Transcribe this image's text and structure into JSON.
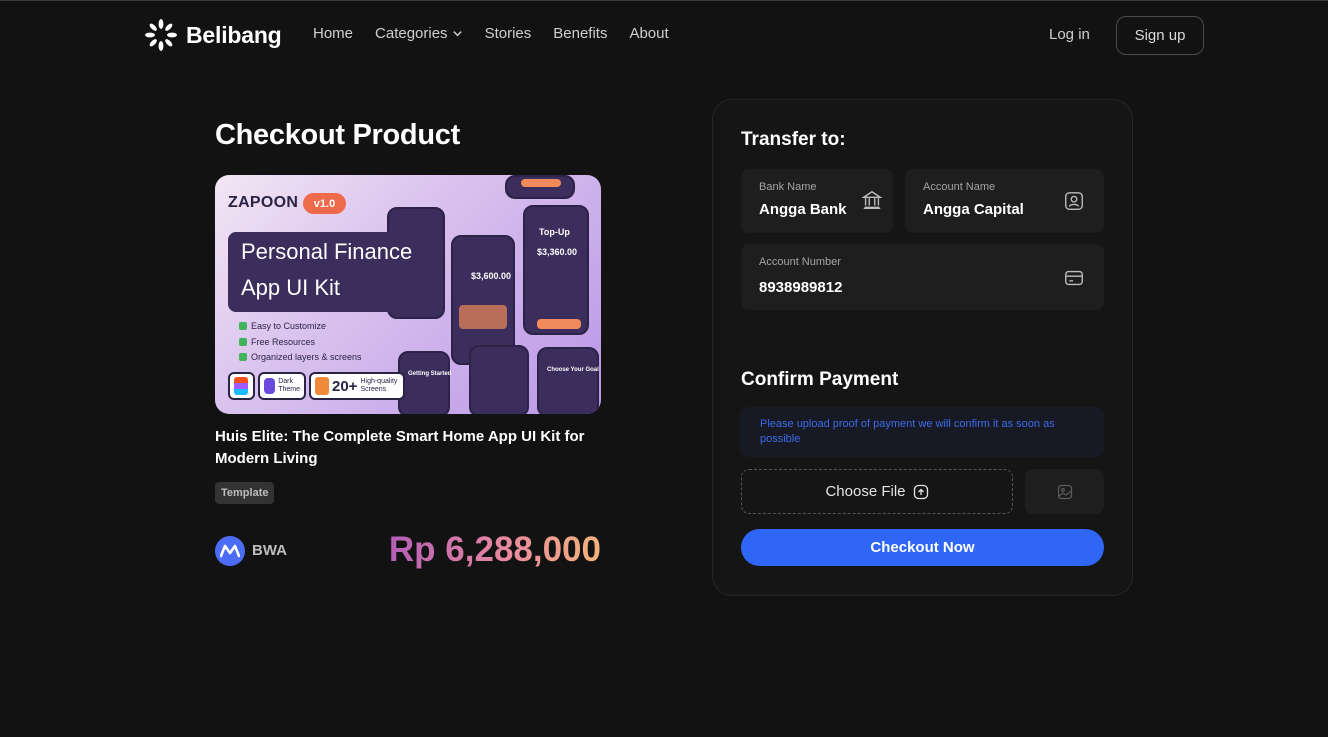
{
  "nav": {
    "brand": "Belibang",
    "links": [
      "Home",
      "Categories",
      "Stories",
      "Benefits",
      "About"
    ],
    "login": "Log in",
    "signup": "Sign up"
  },
  "page": {
    "title": "Checkout Product"
  },
  "thumbnail": {
    "brand": "ZAPOON",
    "version": "v1.0",
    "heading_line1": "Personal Finance",
    "heading_line2": "App UI Kit",
    "features": [
      "Easy to Customize",
      "Free Resources",
      "Organized layers & screens"
    ],
    "badge_theme_1": "Dark",
    "badge_theme_2": "Theme",
    "badge_count": "20+",
    "badge_screens_1": "High-quality",
    "badge_screens_2": "Screens",
    "phone_texts": [
      "$3,600.00",
      "$3,360.00",
      "Top-Up",
      "Choose Your Goal",
      "Getting Started"
    ]
  },
  "product": {
    "name": "Huis Elite: The Complete Smart Home App UI Kit for Modern Living",
    "tag": "Template",
    "seller": "BWA",
    "price": "Rp 6,288,000"
  },
  "transfer": {
    "heading": "Transfer to:",
    "bank_label": "Bank Name",
    "bank_value": "Angga Bank",
    "account_name_label": "Account Name",
    "account_name_value": "Angga Capital",
    "account_number_label": "Account Number",
    "account_number_value": "8938989812"
  },
  "confirm": {
    "heading": "Confirm Payment",
    "notice": "Please upload proof of payment we will confirm it as soon as possible",
    "choose_file": "Choose File",
    "checkout": "Checkout Now"
  },
  "icons": {
    "brand": "sparkle-logo-icon",
    "categories": "chevron-down-icon",
    "bank": "bank-icon",
    "account_name": "user-card-icon",
    "account_number": "credit-card-icon",
    "upload": "upload-icon",
    "preview": "image-icon",
    "seller": "bwa-logo-icon"
  },
  "colors": {
    "background": "#121212",
    "accent": "#2f66f5",
    "price_gradient": [
      "#b45eb8",
      "#e8899f",
      "#f4b27a"
    ]
  }
}
